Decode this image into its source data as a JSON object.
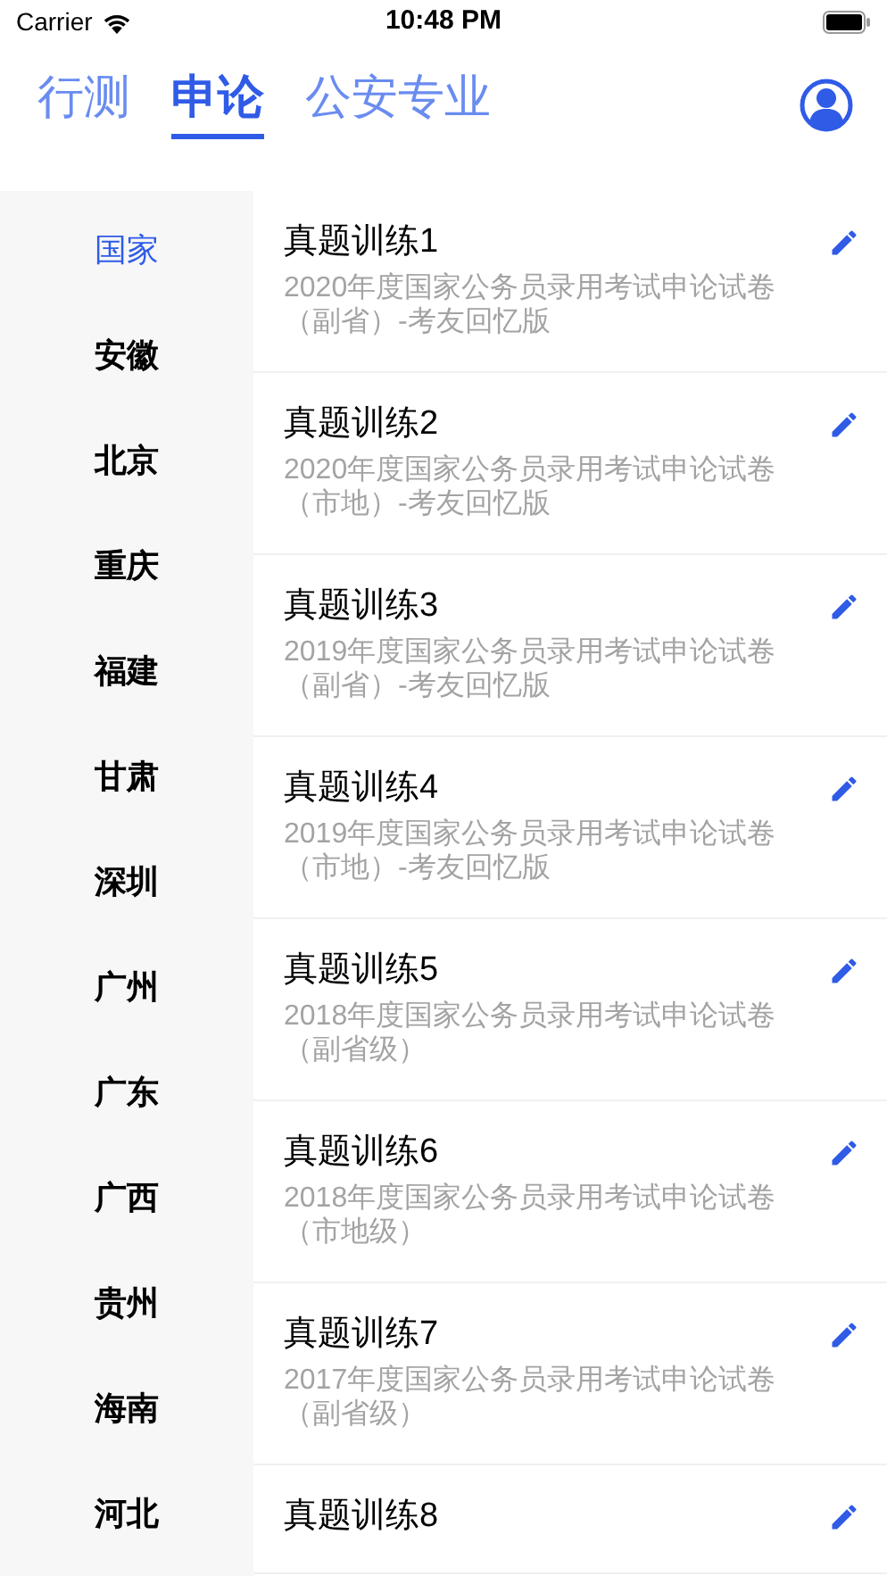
{
  "status_bar": {
    "carrier": "Carrier",
    "time": "10:48 PM"
  },
  "tabs": [
    {
      "label": "行测",
      "selected": false
    },
    {
      "label": "申论",
      "selected": true
    },
    {
      "label": "公安专业",
      "selected": false
    }
  ],
  "regions": [
    {
      "label": "国家",
      "selected": true
    },
    {
      "label": "安徽",
      "selected": false
    },
    {
      "label": "北京",
      "selected": false
    },
    {
      "label": "重庆",
      "selected": false
    },
    {
      "label": "福建",
      "selected": false
    },
    {
      "label": "甘肃",
      "selected": false
    },
    {
      "label": "深圳",
      "selected": false
    },
    {
      "label": "广州",
      "selected": false
    },
    {
      "label": "广东",
      "selected": false
    },
    {
      "label": "广西",
      "selected": false
    },
    {
      "label": "贵州",
      "selected": false
    },
    {
      "label": "海南",
      "selected": false
    },
    {
      "label": "河北",
      "selected": false
    }
  ],
  "papers": [
    {
      "title": "真题训练1",
      "subtitle": "2020年度国家公务员录用考试申论试卷（副省）-考友回忆版"
    },
    {
      "title": "真题训练2",
      "subtitle": "2020年度国家公务员录用考试申论试卷（市地）-考友回忆版"
    },
    {
      "title": "真题训练3",
      "subtitle": "2019年度国家公务员录用考试申论试卷（副省）-考友回忆版"
    },
    {
      "title": "真题训练4",
      "subtitle": "2019年度国家公务员录用考试申论试卷（市地）-考友回忆版"
    },
    {
      "title": "真题训练5",
      "subtitle": "2018年度国家公务员录用考试申论试卷（副省级）"
    },
    {
      "title": "真题训练6",
      "subtitle": "2018年度国家公务员录用考试申论试卷（市地级）"
    },
    {
      "title": "真题训练7",
      "subtitle": "2017年度国家公务员录用考试申论试卷（副省级）"
    },
    {
      "title": "真题训练8"
    }
  ]
}
